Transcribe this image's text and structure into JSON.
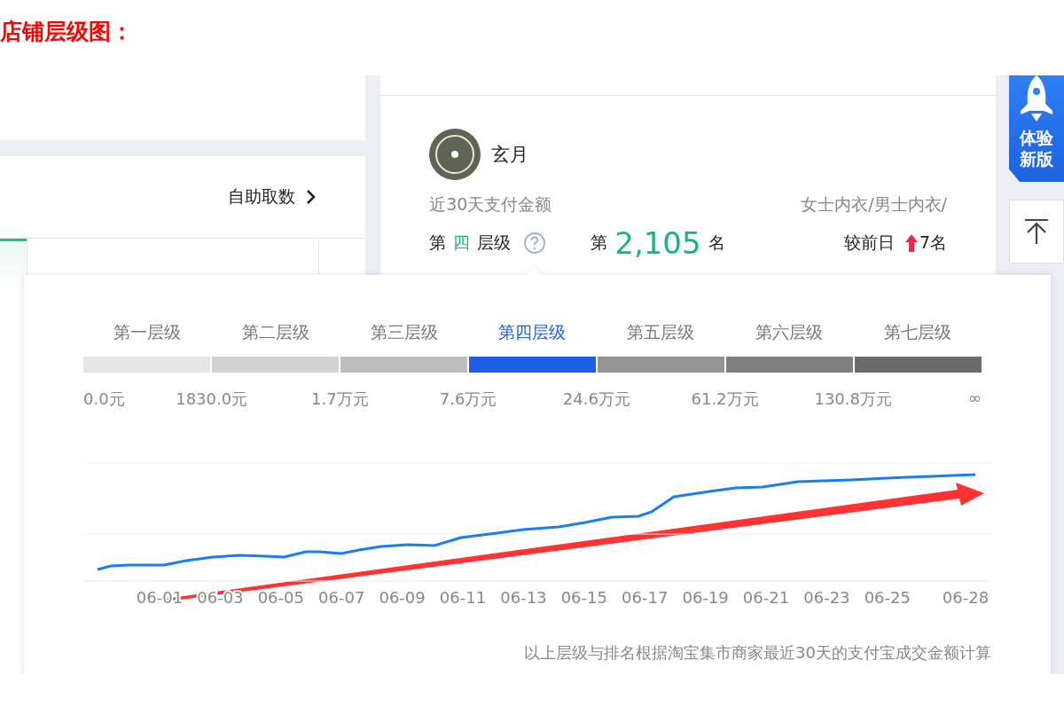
{
  "heading": "店铺层级图：",
  "data_card": {
    "link": "自助取数"
  },
  "shop": {
    "name": "玄月",
    "amount_label": "近30天支付金额",
    "category": "女士内衣/男士内衣/",
    "tier_prefix": "第",
    "tier": "四",
    "tier_suffix": "层级",
    "rank_prefix": "第",
    "rank": "2,105",
    "rank_suffix": "名",
    "compare_label": "较前日",
    "change": "7名"
  },
  "side_buttons": {
    "new_version": "体验新版"
  },
  "popup": {
    "tiers": [
      {
        "label": "第一层级",
        "selected": false
      },
      {
        "label": "第二层级",
        "selected": false
      },
      {
        "label": "第三层级",
        "selected": false
      },
      {
        "label": "第四层级",
        "selected": true
      },
      {
        "label": "第五层级",
        "selected": false
      },
      {
        "label": "第六层级",
        "selected": false
      },
      {
        "label": "第七层级",
        "selected": false
      }
    ],
    "thresholds": [
      "0.0元",
      "1830.0元",
      "1.7万元",
      "7.6万元",
      "24.6万元",
      "61.2万元",
      "130.8万元",
      "∞"
    ],
    "x_labels": [
      "06-01",
      "06-03",
      "06-05",
      "06-07",
      "06-09",
      "06-11",
      "06-13",
      "06-15",
      "06-17",
      "06-19",
      "06-21",
      "06-23",
      "06-25",
      "06-28"
    ],
    "footnote": "以上层级与排名根据淘宝集市商家最近30天的支付宝成交金额计算"
  }
}
